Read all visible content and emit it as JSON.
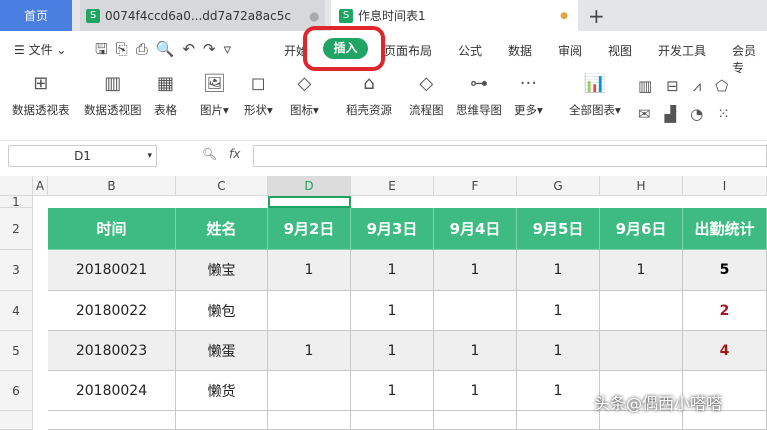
{
  "tabs": {
    "home": "首页",
    "file1": "0074f4ccd6a0...dd7a72a8ac5c",
    "file2": "作息时间表1",
    "new": "+"
  },
  "menu": {
    "file": "文件",
    "items": [
      "开始",
      "插入",
      "页面布局",
      "公式",
      "数据",
      "审阅",
      "视图",
      "开发工具",
      "会员专"
    ]
  },
  "ribbon": {
    "items": [
      "数据透视表",
      "数据透视图",
      "表格",
      "图片",
      "形状",
      "图标",
      "稻壳资源",
      "流程图",
      "思维导图",
      "更多",
      "全部图表"
    ]
  },
  "formula": {
    "cell_ref": "D1",
    "fx": "fx"
  },
  "columns": [
    "A",
    "B",
    "C",
    "D",
    "E",
    "F",
    "G",
    "H",
    "I"
  ],
  "rows": [
    "1",
    "2",
    "3",
    "4",
    "5",
    "6"
  ],
  "table": {
    "headers": [
      "时间",
      "姓名",
      "9月2日",
      "9月3日",
      "9月4日",
      "9月5日",
      "9月6日",
      "出勤统计"
    ],
    "data": [
      [
        "20180021",
        "懒宝",
        "1",
        "1",
        "1",
        "1",
        "1",
        "5"
      ],
      [
        "20180022",
        "懒包",
        "",
        "1",
        "",
        "1",
        "",
        "2"
      ],
      [
        "20180023",
        "懒蛋",
        "1",
        "1",
        "1",
        "1",
        "",
        "4"
      ],
      [
        "20180024",
        "懒货",
        "",
        "1",
        "1",
        "1",
        "",
        ""
      ]
    ]
  },
  "watermark": "头条@偶西小嗒嗒",
  "colors": {
    "accent": "#1fa463",
    "header": "#3dbb82",
    "highlight": "#e0262d"
  }
}
